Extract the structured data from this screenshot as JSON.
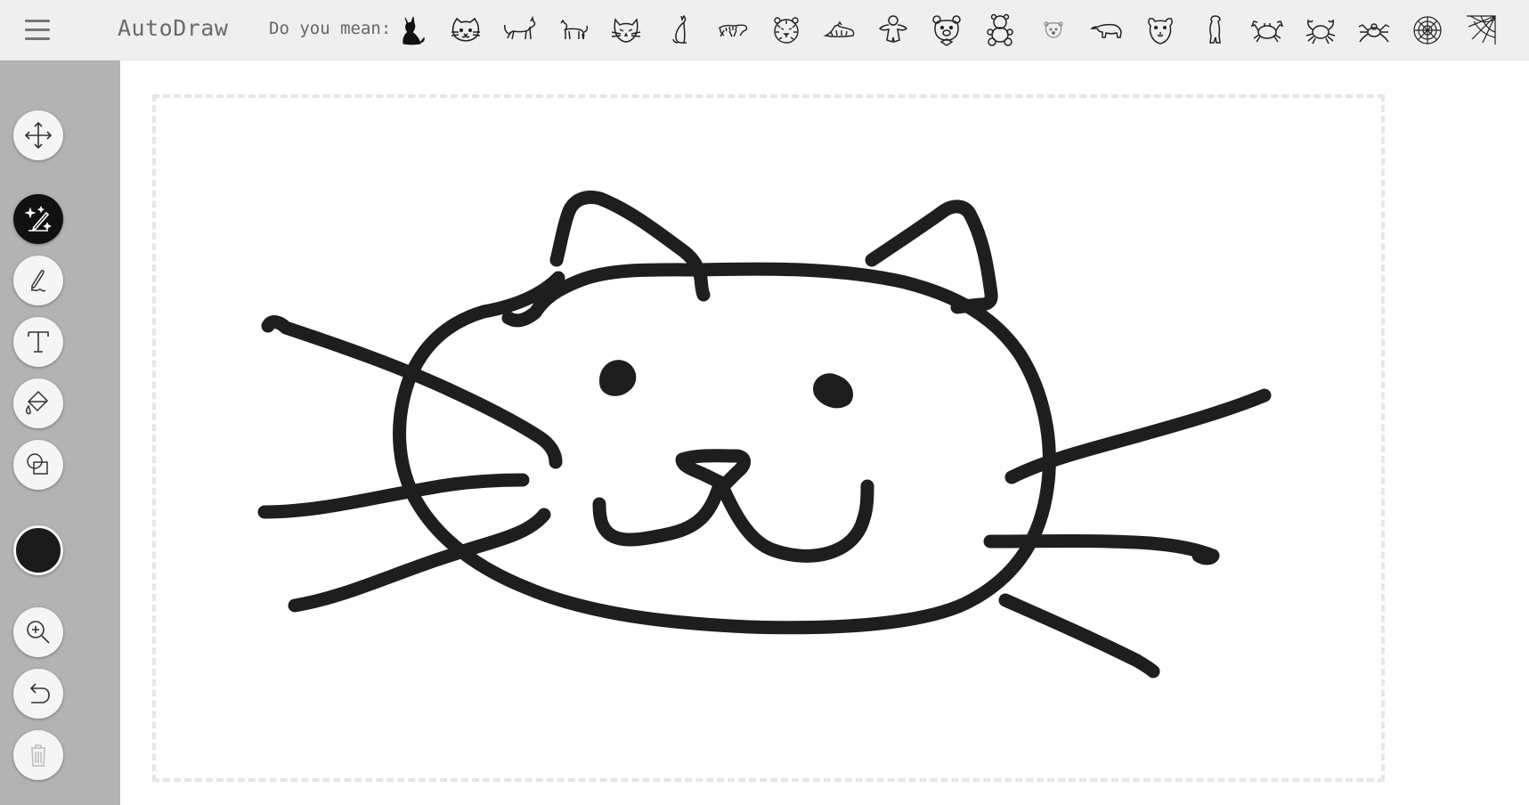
{
  "app": {
    "title": "AutoDraw",
    "menu_icon": "hamburger-menu-icon"
  },
  "suggestions": {
    "label": "Do you mean:",
    "items": [
      {
        "name": "cat-silhouette"
      },
      {
        "name": "cat-face"
      },
      {
        "name": "cat-walking"
      },
      {
        "name": "cat-standing"
      },
      {
        "name": "cat-head"
      },
      {
        "name": "cat-sitting"
      },
      {
        "name": "tiger-running"
      },
      {
        "name": "tiger-face"
      },
      {
        "name": "tiger-lying"
      },
      {
        "name": "teddy-bear-flat"
      },
      {
        "name": "bear-face"
      },
      {
        "name": "teddy-bear"
      },
      {
        "name": "polar-bear-face"
      },
      {
        "name": "polar-bear"
      },
      {
        "name": "bear-head"
      },
      {
        "name": "bear-standing"
      },
      {
        "name": "crab"
      },
      {
        "name": "crab-outline"
      },
      {
        "name": "spider"
      },
      {
        "name": "spider-web"
      },
      {
        "name": "corner-web"
      }
    ]
  },
  "toolbar": {
    "tools": [
      {
        "name": "select-move",
        "icon": "move-arrows-icon",
        "active": false
      },
      {
        "name": "autodraw",
        "icon": "autodraw-sparkle-pencil-icon",
        "active": true
      },
      {
        "name": "draw",
        "icon": "pencil-icon",
        "active": false
      },
      {
        "name": "type",
        "icon": "text-t-icon",
        "active": false
      },
      {
        "name": "fill",
        "icon": "paint-bucket-icon",
        "active": false
      },
      {
        "name": "shape",
        "icon": "shapes-icon",
        "active": false
      },
      {
        "name": "zoom",
        "icon": "zoom-in-icon",
        "active": false
      },
      {
        "name": "undo",
        "icon": "undo-icon",
        "active": false
      },
      {
        "name": "delete",
        "icon": "trash-icon",
        "active": false,
        "disabled": true
      }
    ],
    "current_color": "#1a1a1a"
  },
  "colors": {
    "topbar_bg": "#efefef",
    "sidebar_bg": "#b3b3b3",
    "stroke": "#1e1e1e"
  }
}
